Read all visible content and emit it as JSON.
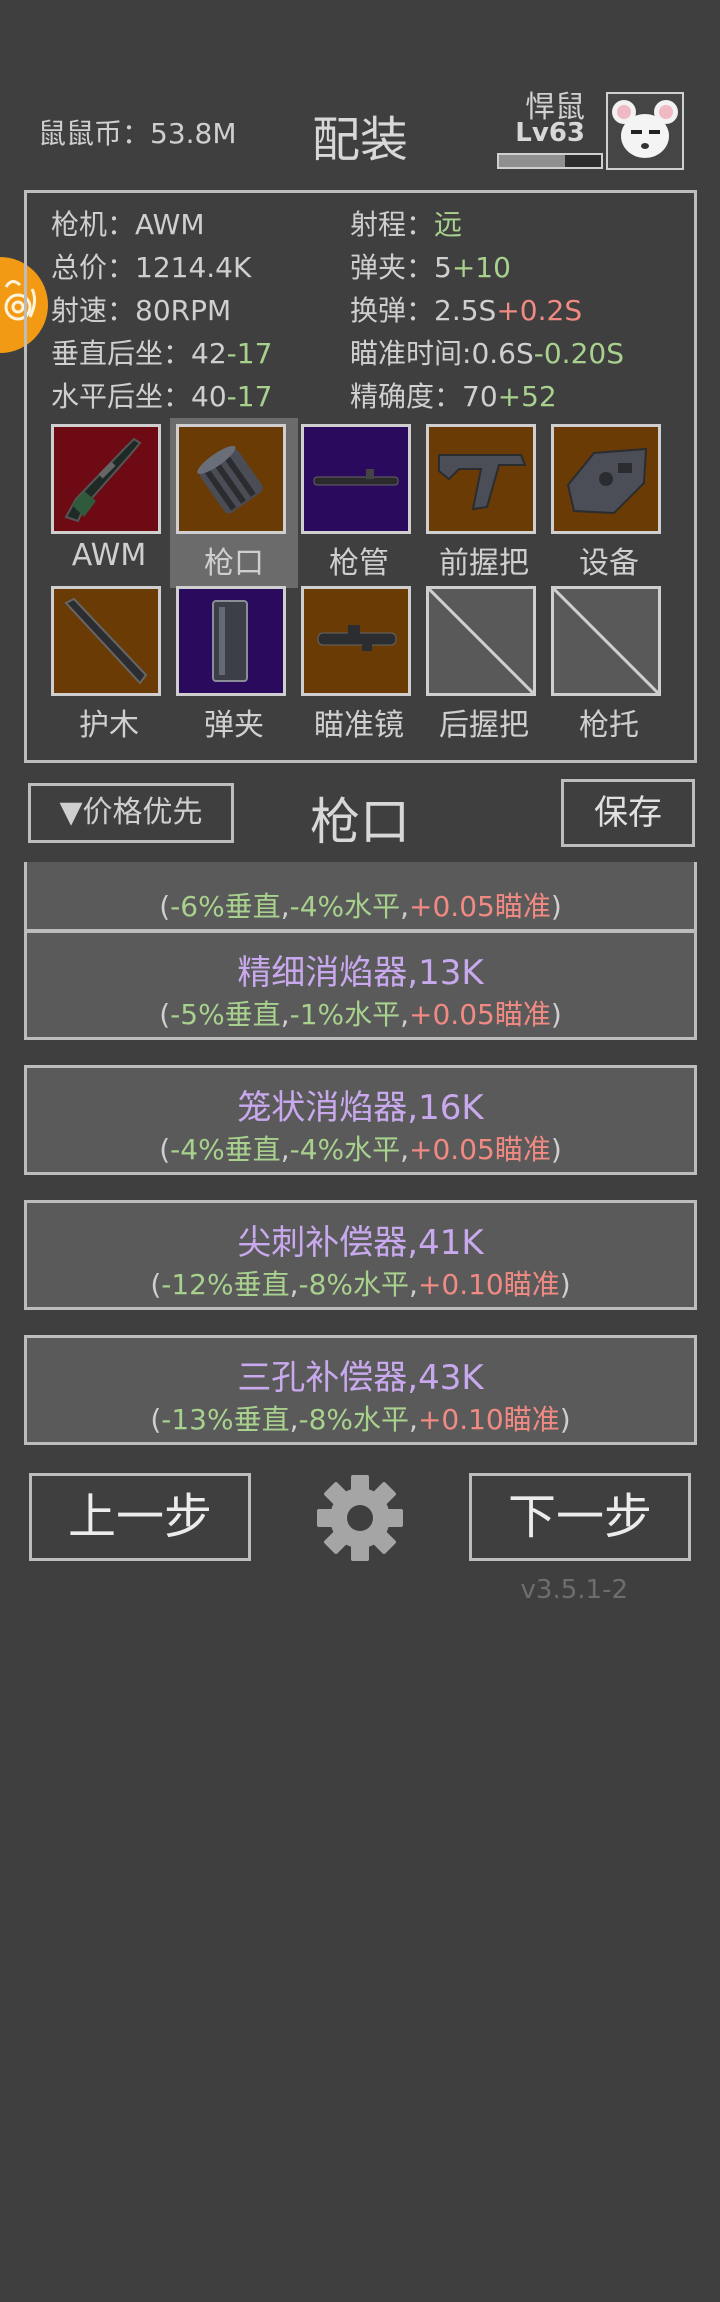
{
  "header": {
    "coins_label": "鼠鼠币：",
    "coins_value": "53.8M",
    "title": "配装",
    "player": {
      "name": "悍鼠",
      "level": "Lv63",
      "xp_fraction": 0.65
    }
  },
  "stats": {
    "gun": {
      "label": "枪机：",
      "value": "AWM"
    },
    "range": {
      "label": "射程：",
      "value": "远"
    },
    "price": {
      "label": "总价：",
      "value": "1214.4K"
    },
    "magazine": {
      "label": "弹夹：",
      "base": "5",
      "mod": "+10"
    },
    "rate": {
      "label": "射速：",
      "value": "80RPM"
    },
    "reload": {
      "label": "换弹：",
      "base": "2.5S",
      "mod": "+0.2S"
    },
    "vrecoil": {
      "label": "垂直后坐：",
      "base": "42",
      "mod": "-17"
    },
    "aimtime": {
      "label": "瞄准时间:",
      "base": "0.6S",
      "mod": "-0.20S"
    },
    "hrecoil": {
      "label": "水平后坐：",
      "base": "40",
      "mod": "-17"
    },
    "accuracy": {
      "label": "精确度：",
      "base": "70",
      "mod": "+52"
    }
  },
  "slots": [
    {
      "label": "AWM",
      "icon": "awm-rifle-icon",
      "color": "#6d0a14"
    },
    {
      "label": "枪口",
      "icon": "muzzle-icon",
      "color": "#6a3b04",
      "selected": true
    },
    {
      "label": "枪管",
      "icon": "barrel-icon",
      "color": "#2a0a5c"
    },
    {
      "label": "前握把",
      "icon": "foregrip-icon",
      "color": "#6a3b04"
    },
    {
      "label": "设备",
      "icon": "device-icon",
      "color": "#6a3b04"
    },
    {
      "label": "护木",
      "icon": "handguard-icon",
      "color": "#6a3b04"
    },
    {
      "label": "弹夹",
      "icon": "magazine-icon",
      "color": "#2a0a5c"
    },
    {
      "label": "瞄准镜",
      "icon": "scope-icon",
      "color": "#6a3b04"
    },
    {
      "label": "后握把",
      "icon": "empty-slot-icon",
      "color": "#595959"
    },
    {
      "label": "枪托",
      "icon": "empty-slot-icon",
      "color": "#595959"
    }
  ],
  "controls": {
    "sort_label": "▼价格优先",
    "section_title": "枪口",
    "save_label": "保存"
  },
  "items": [
    {
      "name": "",
      "vert": "-6%垂直",
      "horiz": "-4%水平",
      "aim": "+0.05瞄准"
    },
    {
      "name": "精细消焰器,13K",
      "vert": "-5%垂直",
      "horiz": "-1%水平",
      "aim": "+0.05瞄准"
    },
    {
      "name": "笼状消焰器,16K",
      "vert": "-4%垂直",
      "horiz": "-4%水平",
      "aim": "+0.05瞄准"
    },
    {
      "name": "尖刺补偿器,41K",
      "vert": "-12%垂直",
      "horiz": "-8%水平",
      "aim": "+0.10瞄准"
    },
    {
      "name": "三孔补偿器,43K",
      "vert": "-13%垂直",
      "horiz": "-8%水平",
      "aim": "+0.10瞄准"
    }
  ],
  "bottom": {
    "prev_label": "上一步",
    "next_label": "下一步",
    "settings_icon": "gear-icon",
    "version": "v3.5.1-2"
  },
  "colors": {
    "background": "#3f3f3f",
    "positive": "#a8d18e",
    "negative": "#f08a82",
    "item_name": "#c9a9ee"
  }
}
